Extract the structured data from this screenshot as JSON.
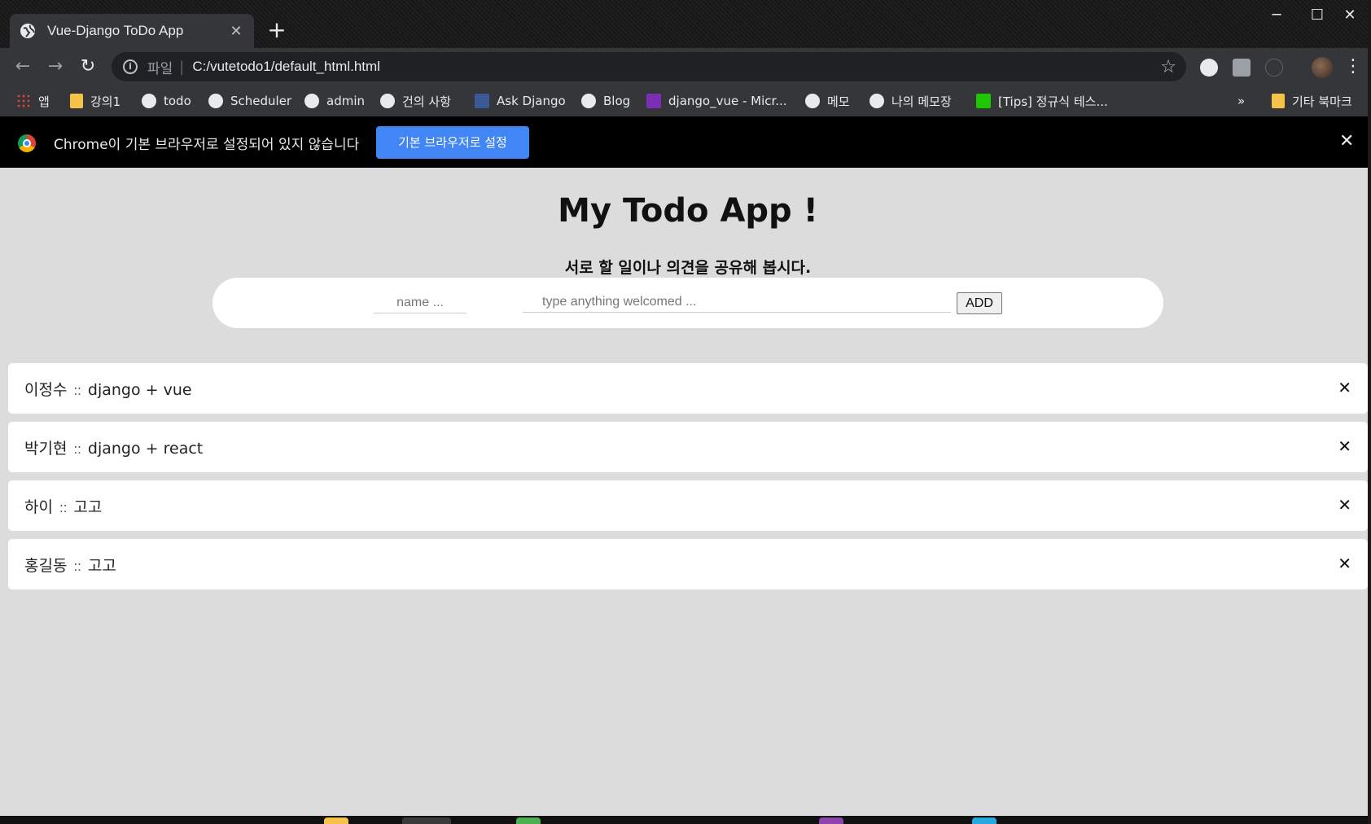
{
  "browser": {
    "tab_title": "Vue-Django ToDo App",
    "tab_close": "✕",
    "new_tab": "+",
    "window_controls": {
      "minimize": "─",
      "maximize": "☐",
      "close": "✕"
    },
    "nav": {
      "back": "←",
      "forward": "→",
      "reload": "↻"
    },
    "omnibox": {
      "info": "i",
      "scheme": "파일",
      "separator": "|",
      "url": "C:/vutetodo1/default_html.html",
      "star": "☆"
    },
    "menu": "⋮",
    "bookmarks": [
      {
        "label": "앱",
        "icon": "apps-icon"
      },
      {
        "label": "강의1",
        "icon": "folder-icon"
      },
      {
        "label": "todo",
        "icon": "globe-icon"
      },
      {
        "label": "Scheduler",
        "icon": "globe-icon"
      },
      {
        "label": "admin",
        "icon": "globe-icon"
      },
      {
        "label": "건의 사항",
        "icon": "globe-icon"
      },
      {
        "label": "Ask Django",
        "icon": "facebook-icon"
      },
      {
        "label": "Blog",
        "icon": "globe-icon"
      },
      {
        "label": "django_vue - Micr...",
        "icon": "onenote-icon"
      },
      {
        "label": "메모",
        "icon": "globe-icon"
      },
      {
        "label": "나의 메모장",
        "icon": "globe-icon"
      },
      {
        "label": "[Tips] 정규식 테스...",
        "icon": "memo-icon"
      }
    ],
    "bookmarks_overflow": "»",
    "other_bookmarks": "기타 북마크"
  },
  "infobar": {
    "message": "Chrome이 기본 브라우저로 설정되어 있지 않습니다",
    "button_label": "기본 브라우저로 설정",
    "close": "✕"
  },
  "app": {
    "title": "My Todo App !",
    "subtitle": "서로 할 일이나 의견을 공유해 봅시다.",
    "name_placeholder": "name ...",
    "todo_placeholder": "type anything welcomed ...",
    "add_label": "ADD",
    "separator": "::",
    "delete_symbol": "✕",
    "todos": [
      {
        "name": "이정수",
        "text": "django + vue"
      },
      {
        "name": "박기현",
        "text": "django + react"
      },
      {
        "name": "하이",
        "text": "고고"
      },
      {
        "name": "홍길동",
        "text": "고고"
      }
    ]
  },
  "colors": {
    "page_bg": "#dcdcdc",
    "infobar_button": "#4285f4",
    "chrome_dark": "#35363a"
  }
}
